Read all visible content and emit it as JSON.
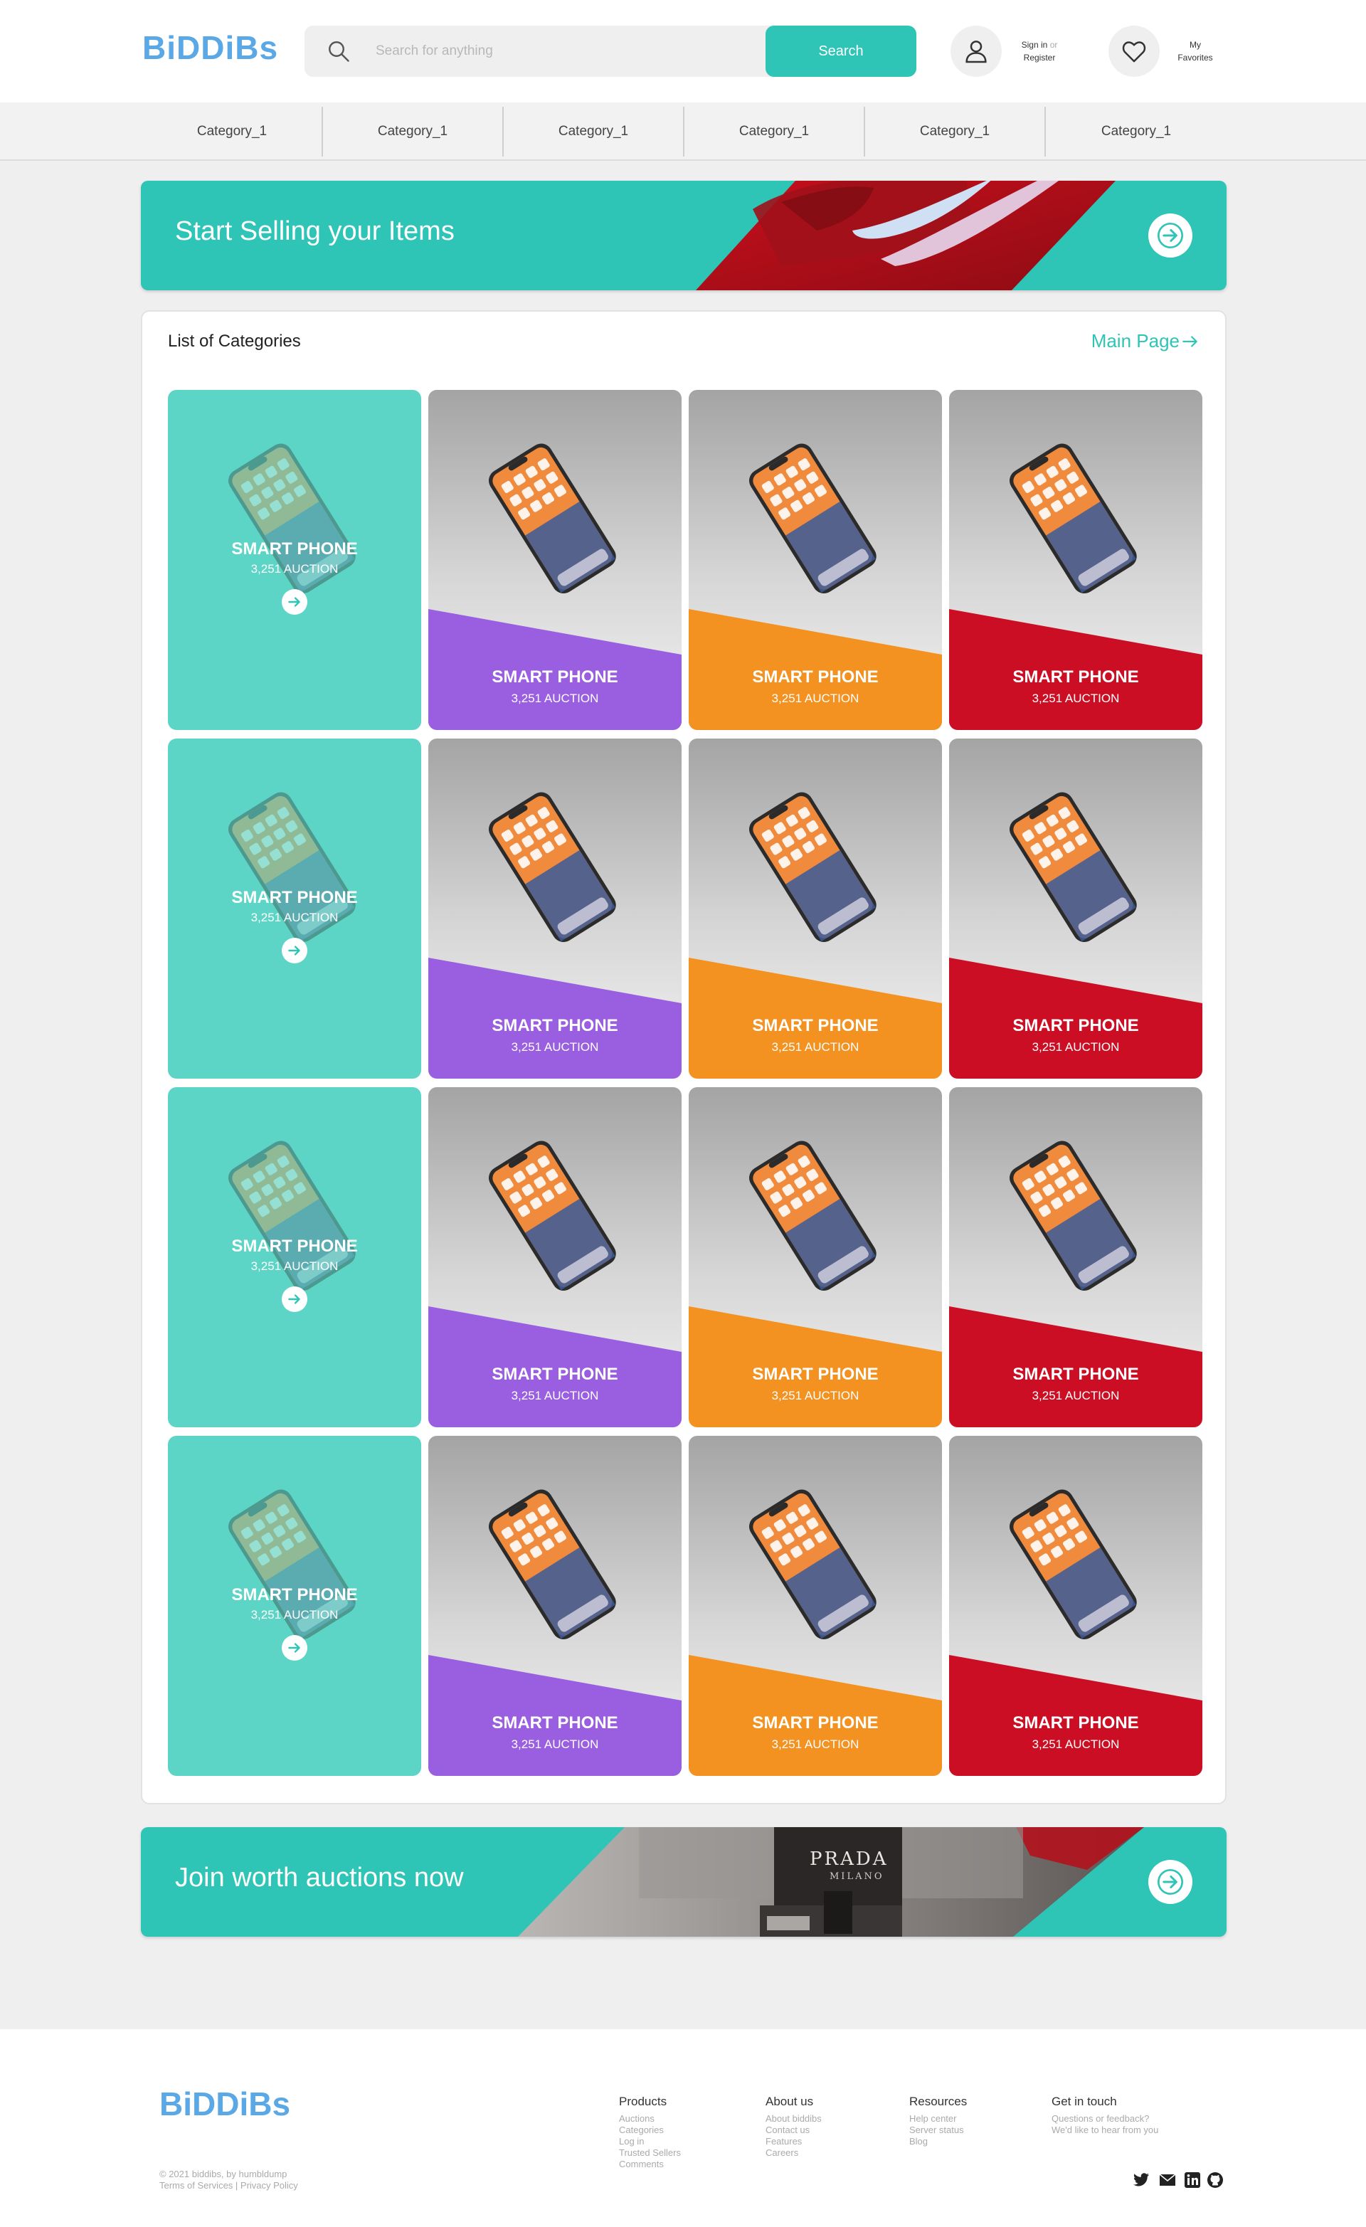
{
  "header": {
    "logo": "BiDDiBs",
    "search_placeholder": "Search for anything",
    "search_button": "Search",
    "account": {
      "sign_in": "Sign in",
      "or": "or",
      "register": "Register"
    },
    "favorites": {
      "line1": "My",
      "line2": "Favorites"
    }
  },
  "categories": [
    "Category_1",
    "Category_1",
    "Category_1",
    "Category_1",
    "Category_1",
    "Category_1"
  ],
  "banner_top": {
    "title": "Start Selling your Items"
  },
  "panel": {
    "title": "List of Categories",
    "link": "Main Page",
    "rows": [
      {
        "teal": {
          "label": "SMART PHONE",
          "count": "3,251 AUCTION"
        },
        "cards": [
          {
            "label": "SMART PHONE",
            "count": "3,251 AUCTION",
            "color": "#9a5fe0"
          },
          {
            "label": "SMART PHONE",
            "count": "3,251 AUCTION",
            "color": "#f39220"
          },
          {
            "label": "SMART PHONE",
            "count": "3,251 AUCTION",
            "color": "#cc0e24"
          }
        ]
      },
      {
        "teal": {
          "label": "SMART PHONE",
          "count": "3,251 AUCTION"
        },
        "cards": [
          {
            "label": "SMART PHONE",
            "count": "3,251 AUCTION",
            "color": "#9a5fe0"
          },
          {
            "label": "SMART PHONE",
            "count": "3,251 AUCTION",
            "color": "#f39220"
          },
          {
            "label": "SMART PHONE",
            "count": "3,251 AUCTION",
            "color": "#cc0e24"
          }
        ]
      },
      {
        "teal": {
          "label": "SMART PHONE",
          "count": "3,251 AUCTION"
        },
        "cards": [
          {
            "label": "SMART PHONE",
            "count": "3,251 AUCTION",
            "color": "#9a5fe0"
          },
          {
            "label": "SMART PHONE",
            "count": "3,251 AUCTION",
            "color": "#f39220"
          },
          {
            "label": "SMART PHONE",
            "count": "3,251 AUCTION",
            "color": "#cc0e24"
          }
        ]
      },
      {
        "teal": {
          "label": "SMART PHONE",
          "count": "3,251 AUCTION"
        },
        "cards": [
          {
            "label": "SMART PHONE",
            "count": "3,251 AUCTION",
            "color": "#9a5fe0"
          },
          {
            "label": "SMART PHONE",
            "count": "3,251 AUCTION",
            "color": "#f39220"
          },
          {
            "label": "SMART PHONE",
            "count": "3,251 AUCTION",
            "color": "#cc0e24"
          }
        ]
      }
    ]
  },
  "banner_bottom": {
    "title": "Join worth auctions now",
    "bag_brand": "PRADA",
    "bag_city": "MILANO"
  },
  "footer": {
    "logo": "BiDDiBs",
    "copyright": "© 2021 biddibs, by humbldump",
    "legal": "Terms of Services | Privacy Policy",
    "columns": [
      {
        "title": "Products",
        "items": [
          "Auctions",
          "Categories",
          "Log in",
          "Trusted Sellers",
          "Comments"
        ]
      },
      {
        "title": "About us",
        "items": [
          "About biddibs",
          "Contact us",
          "Features",
          "Careers"
        ]
      },
      {
        "title": "Resources",
        "items": [
          "Help center",
          "Server status",
          "Blog"
        ]
      },
      {
        "title": "Get in touch",
        "items": [
          "Questions or feedback?",
          "We'd like to hear from you"
        ]
      }
    ],
    "social_icons": [
      "twitter-icon",
      "mail-icon",
      "linkedin-icon",
      "github-icon"
    ]
  },
  "colors": {
    "accent": "#2ec4b6",
    "logo": "#5aa9e6",
    "purple": "#9a5fe0",
    "orange": "#f39220",
    "red": "#cc0e24",
    "teal_card": "#5dd5c6"
  }
}
